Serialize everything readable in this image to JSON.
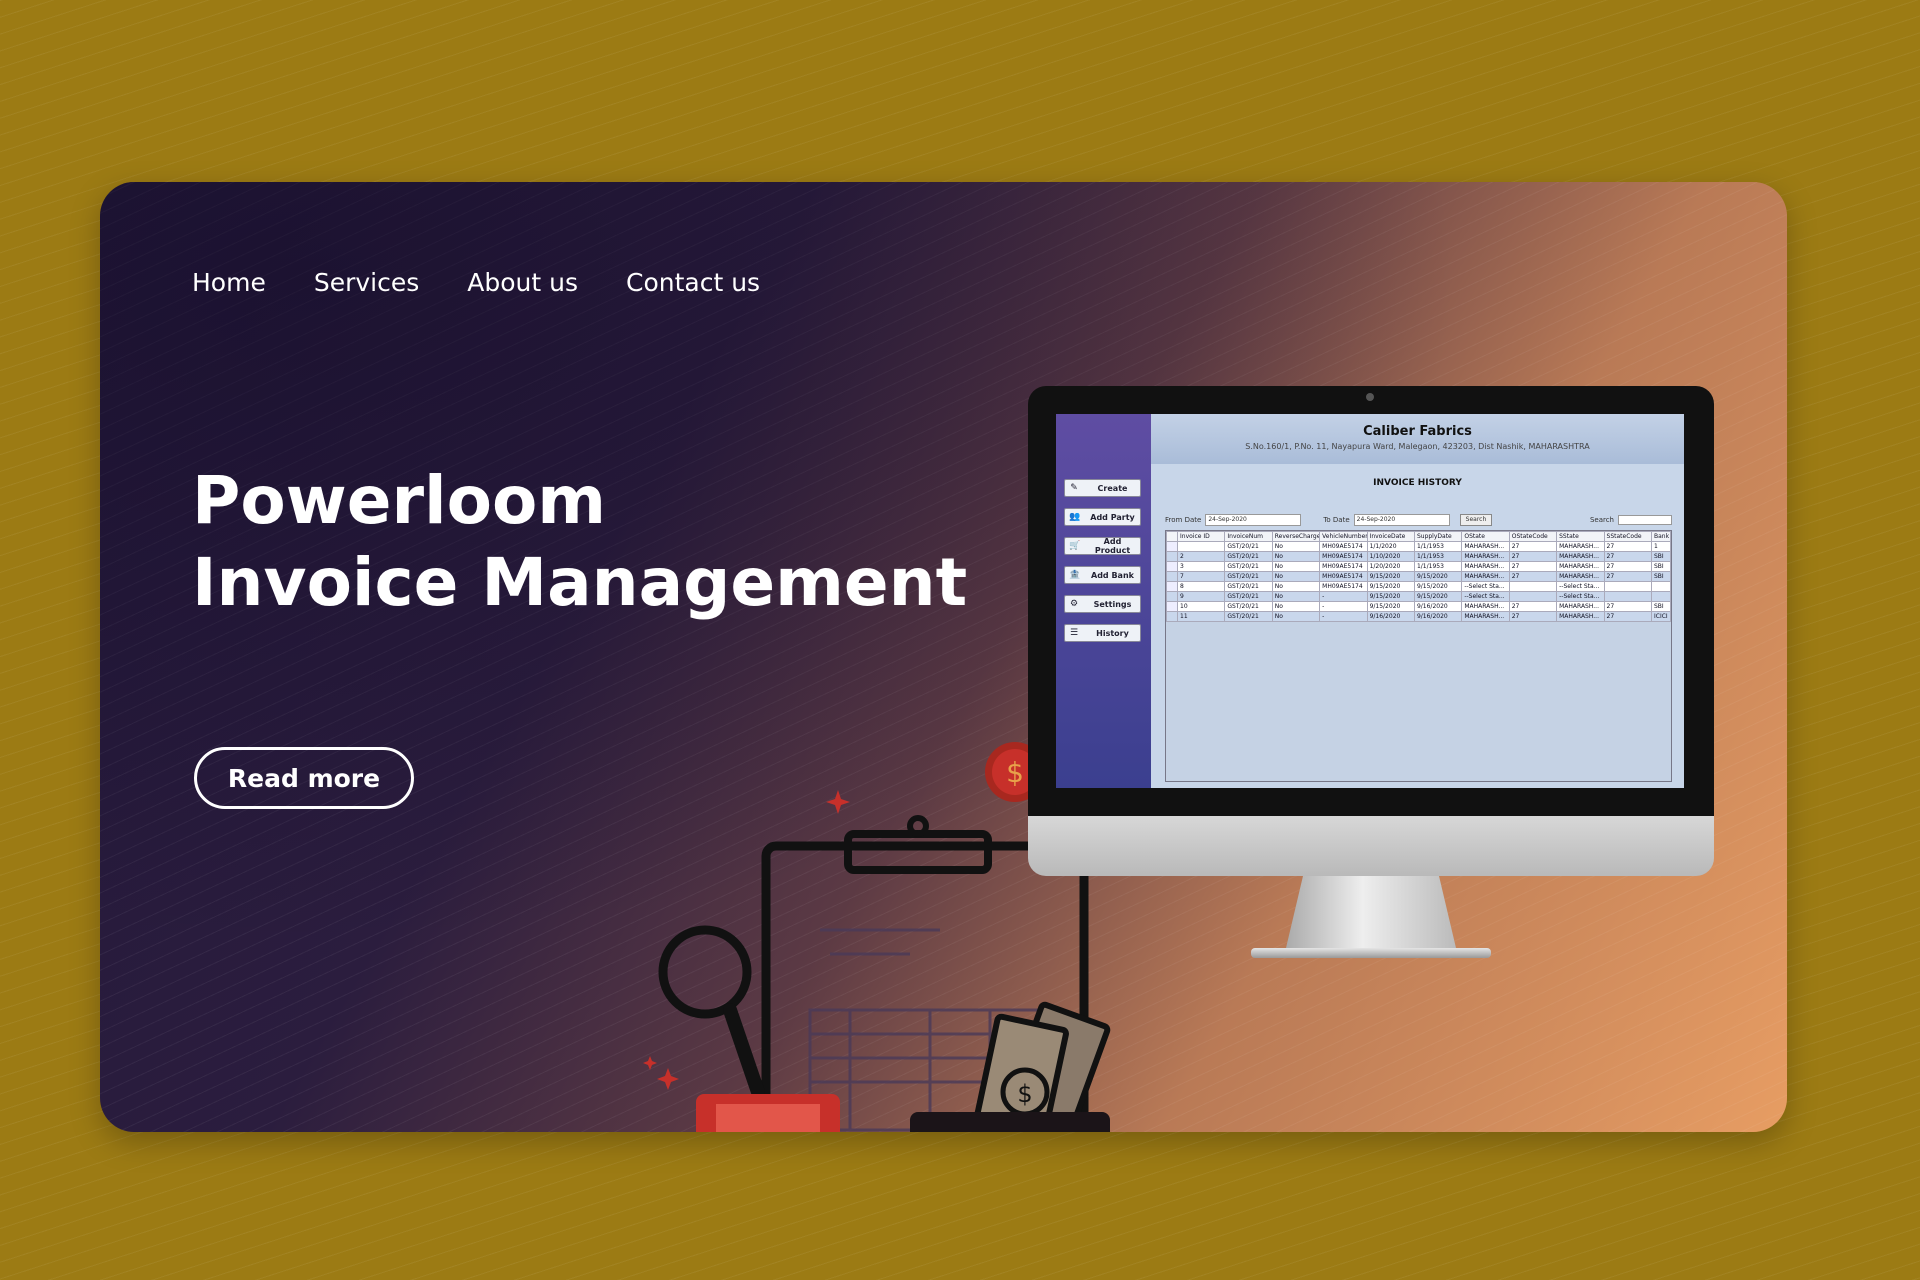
{
  "nav": [
    {
      "label": "Home"
    },
    {
      "label": "Services"
    },
    {
      "label": "About us"
    },
    {
      "label": "Contact us"
    }
  ],
  "hero": {
    "title_line1": "Powerloom",
    "title_line2": "Invoice Management",
    "cta_label": "Read more"
  },
  "illustration": {
    "icons": [
      "clipboard-icon",
      "magnifier-icon",
      "calculator-icon",
      "wallet-icon",
      "banknotes-icon",
      "dollar-coin-icon"
    ],
    "coin_symbol": "$",
    "colors": {
      "accent_red": "#c7302a",
      "outline": "#111111"
    }
  },
  "app": {
    "company": "Caliber Fabrics",
    "address": "S.No.160/1, P.No. 11, Nayapura Ward, Malegaon, 423203, Dist Nashik, MAHARASHTRA",
    "section_title": "INVOICE HISTORY",
    "sidebar": [
      {
        "label": "Create",
        "icon": "✎"
      },
      {
        "label": "Add Party",
        "icon": "👥"
      },
      {
        "label": "Add Product",
        "icon": "🛒"
      },
      {
        "label": "Add Bank",
        "icon": "🏦"
      },
      {
        "label": "Settings",
        "icon": "⚙"
      },
      {
        "label": "History",
        "icon": "☰"
      }
    ],
    "filters": {
      "from_label": "From Date",
      "from_value": "24-Sep-2020",
      "to_label": "To Date",
      "to_value": "24-Sep-2020",
      "search_button": "Search",
      "search_label": "Search"
    },
    "columns": [
      "Invoice ID",
      "InvoiceNum",
      "ReverseCharge",
      "VehicleNumber",
      "InvoiceDate",
      "SupplyDate",
      "OState",
      "OStateCode",
      "SState",
      "SStateCode",
      "Bank"
    ],
    "rows": [
      [
        "",
        "GST/20/21",
        "No",
        "MH09AE5174",
        "1/1/2020",
        "1/1/1953",
        "MAHARASH...",
        "27",
        "MAHARASH...",
        "27",
        "1"
      ],
      [
        "2",
        "GST/20/21",
        "No",
        "MH09AE5174",
        "1/10/2020",
        "1/1/1953",
        "MAHARASH...",
        "27",
        "MAHARASH...",
        "27",
        "SBI"
      ],
      [
        "3",
        "GST/20/21",
        "No",
        "MH09AE5174",
        "1/20/2020",
        "1/1/1953",
        "MAHARASH...",
        "27",
        "MAHARASH...",
        "27",
        "SBI"
      ],
      [
        "7",
        "GST/20/21",
        "No",
        "MH09AE5174",
        "9/15/2020",
        "9/15/2020",
        "MAHARASH...",
        "27",
        "MAHARASH...",
        "27",
        "SBI"
      ],
      [
        "8",
        "GST/20/21",
        "No",
        "MH09AE5174",
        "9/15/2020",
        "9/15/2020",
        "--Select Sta...",
        "",
        "--Select Sta...",
        "",
        ""
      ],
      [
        "9",
        "GST/20/21",
        "No",
        "-",
        "9/15/2020",
        "9/15/2020",
        "--Select Sta...",
        "",
        "--Select Sta...",
        "",
        ""
      ],
      [
        "10",
        "GST/20/21",
        "No",
        "-",
        "9/15/2020",
        "9/16/2020",
        "MAHARASH...",
        "27",
        "MAHARASH...",
        "27",
        "SBI"
      ],
      [
        "11",
        "GST/20/21",
        "No",
        "-",
        "9/16/2020",
        "9/16/2020",
        "MAHARASH...",
        "27",
        "MAHARASH...",
        "27",
        "ICICI"
      ]
    ]
  }
}
